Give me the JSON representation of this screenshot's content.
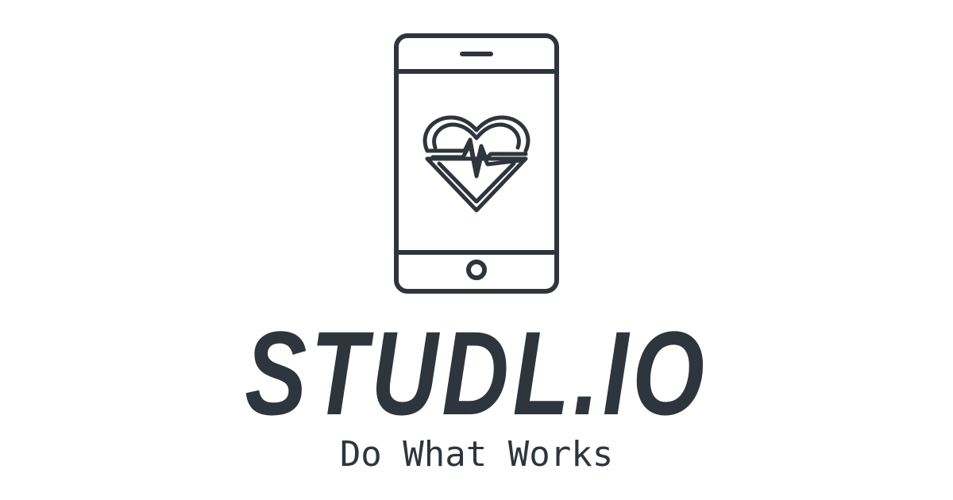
{
  "brand": {
    "name": "STUDL.IO",
    "tagline": "Do What Works"
  },
  "icons": {
    "phone": "smartphone-icon",
    "heart": "heart-pulse-icon"
  },
  "colors": {
    "ink": "#2f353d",
    "background": "#ffffff"
  }
}
